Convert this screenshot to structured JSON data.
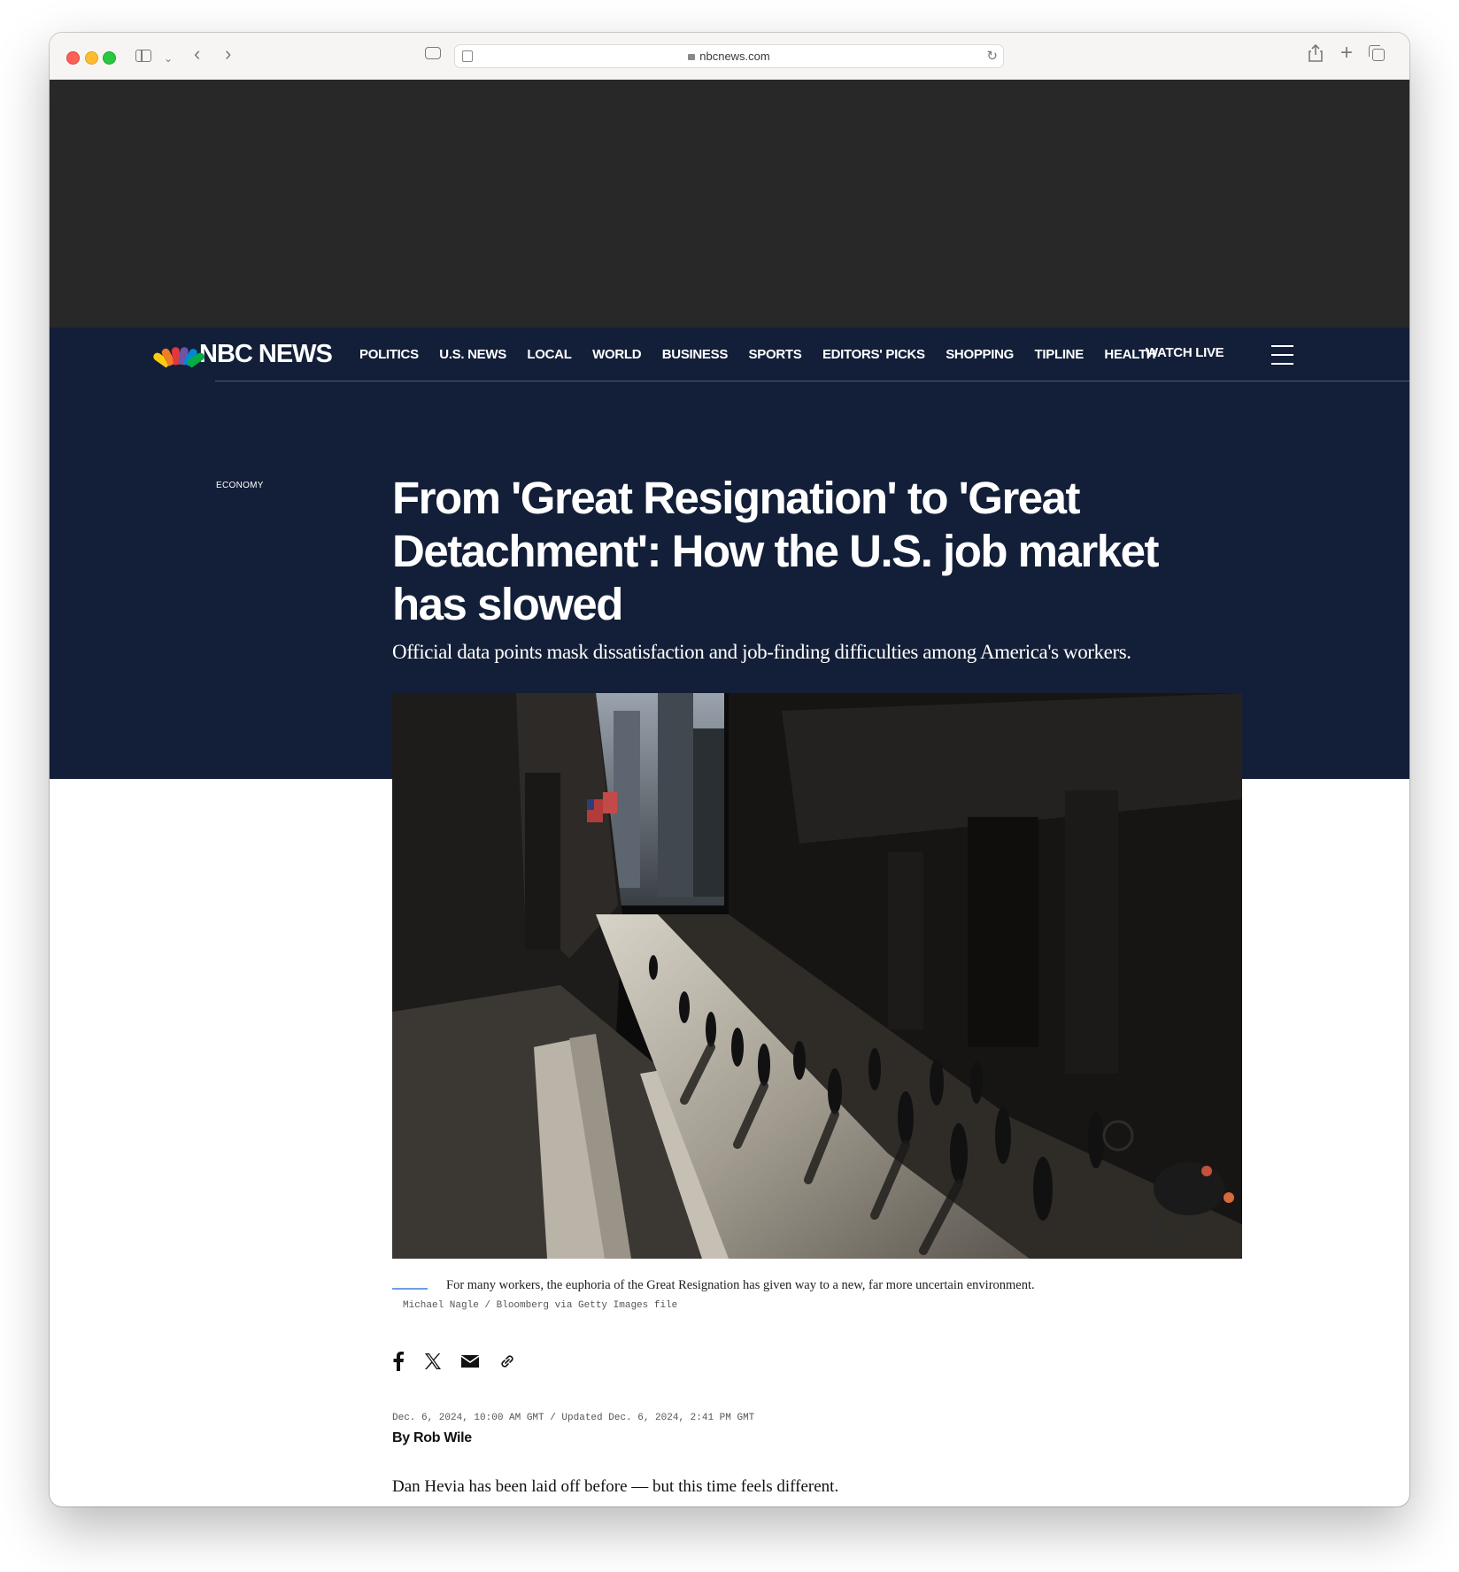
{
  "browser": {
    "url": "nbcnews.com"
  },
  "nav": {
    "logo": "NBC NEWS",
    "items": [
      "POLITICS",
      "U.S. NEWS",
      "LOCAL",
      "WORLD",
      "BUSINESS",
      "SPORTS",
      "EDITORS' PICKS",
      "SHOPPING",
      "TIPLINE",
      "HEALTH"
    ],
    "watch_live": "WATCH LIVE"
  },
  "article": {
    "section": "ECONOMY",
    "headline": "From 'Great Resignation' to 'Great Detachment': How the U.S. job market has slowed",
    "dek": "Official data points mask dissatisfaction and job-finding difficulties among America's workers.",
    "caption": "For many workers, the euphoria of the Great Resignation has given way to a new, far more uncertain environment.",
    "credit": "Michael Nagle / Bloomberg via Getty Images file",
    "dates": "Dec. 6, 2024, 10:00 AM GMT / Updated Dec. 6, 2024, 2:41 PM GMT",
    "byline": "By Rob Wile",
    "first_paragraph": "Dan Hevia has been laid off before — but this time feels different."
  },
  "share_icons": [
    "facebook-icon",
    "x-icon",
    "email-icon",
    "link-icon"
  ],
  "colors": {
    "navy": "#131f38",
    "ad_bg": "#282828",
    "caption_accent": "#6f9de8"
  }
}
